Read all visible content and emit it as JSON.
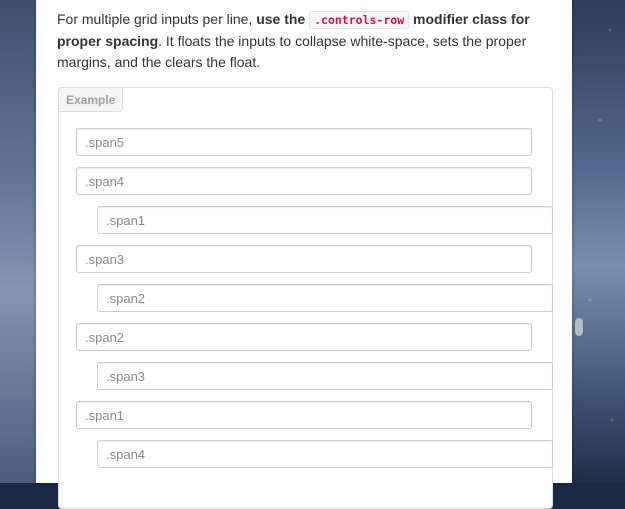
{
  "intro": {
    "text_before": "For multiple grid inputs per line, ",
    "bold_use_the": "use the",
    "code_class": ".controls-row",
    "bold_after": "modifier class for proper spacing",
    "text_after": ". It floats the inputs to collapse white-space, sets the proper margins, and the clears the float."
  },
  "example": {
    "label": "Example",
    "inputs": [
      {
        "placeholder": ".span5"
      },
      {
        "placeholder": ".span4"
      },
      {
        "placeholder": ".span1"
      },
      {
        "placeholder": ".span3"
      },
      {
        "placeholder": ".span2"
      },
      {
        "placeholder": ".span2"
      },
      {
        "placeholder": ".span3"
      },
      {
        "placeholder": ".span1"
      },
      {
        "placeholder": ".span4"
      }
    ]
  }
}
